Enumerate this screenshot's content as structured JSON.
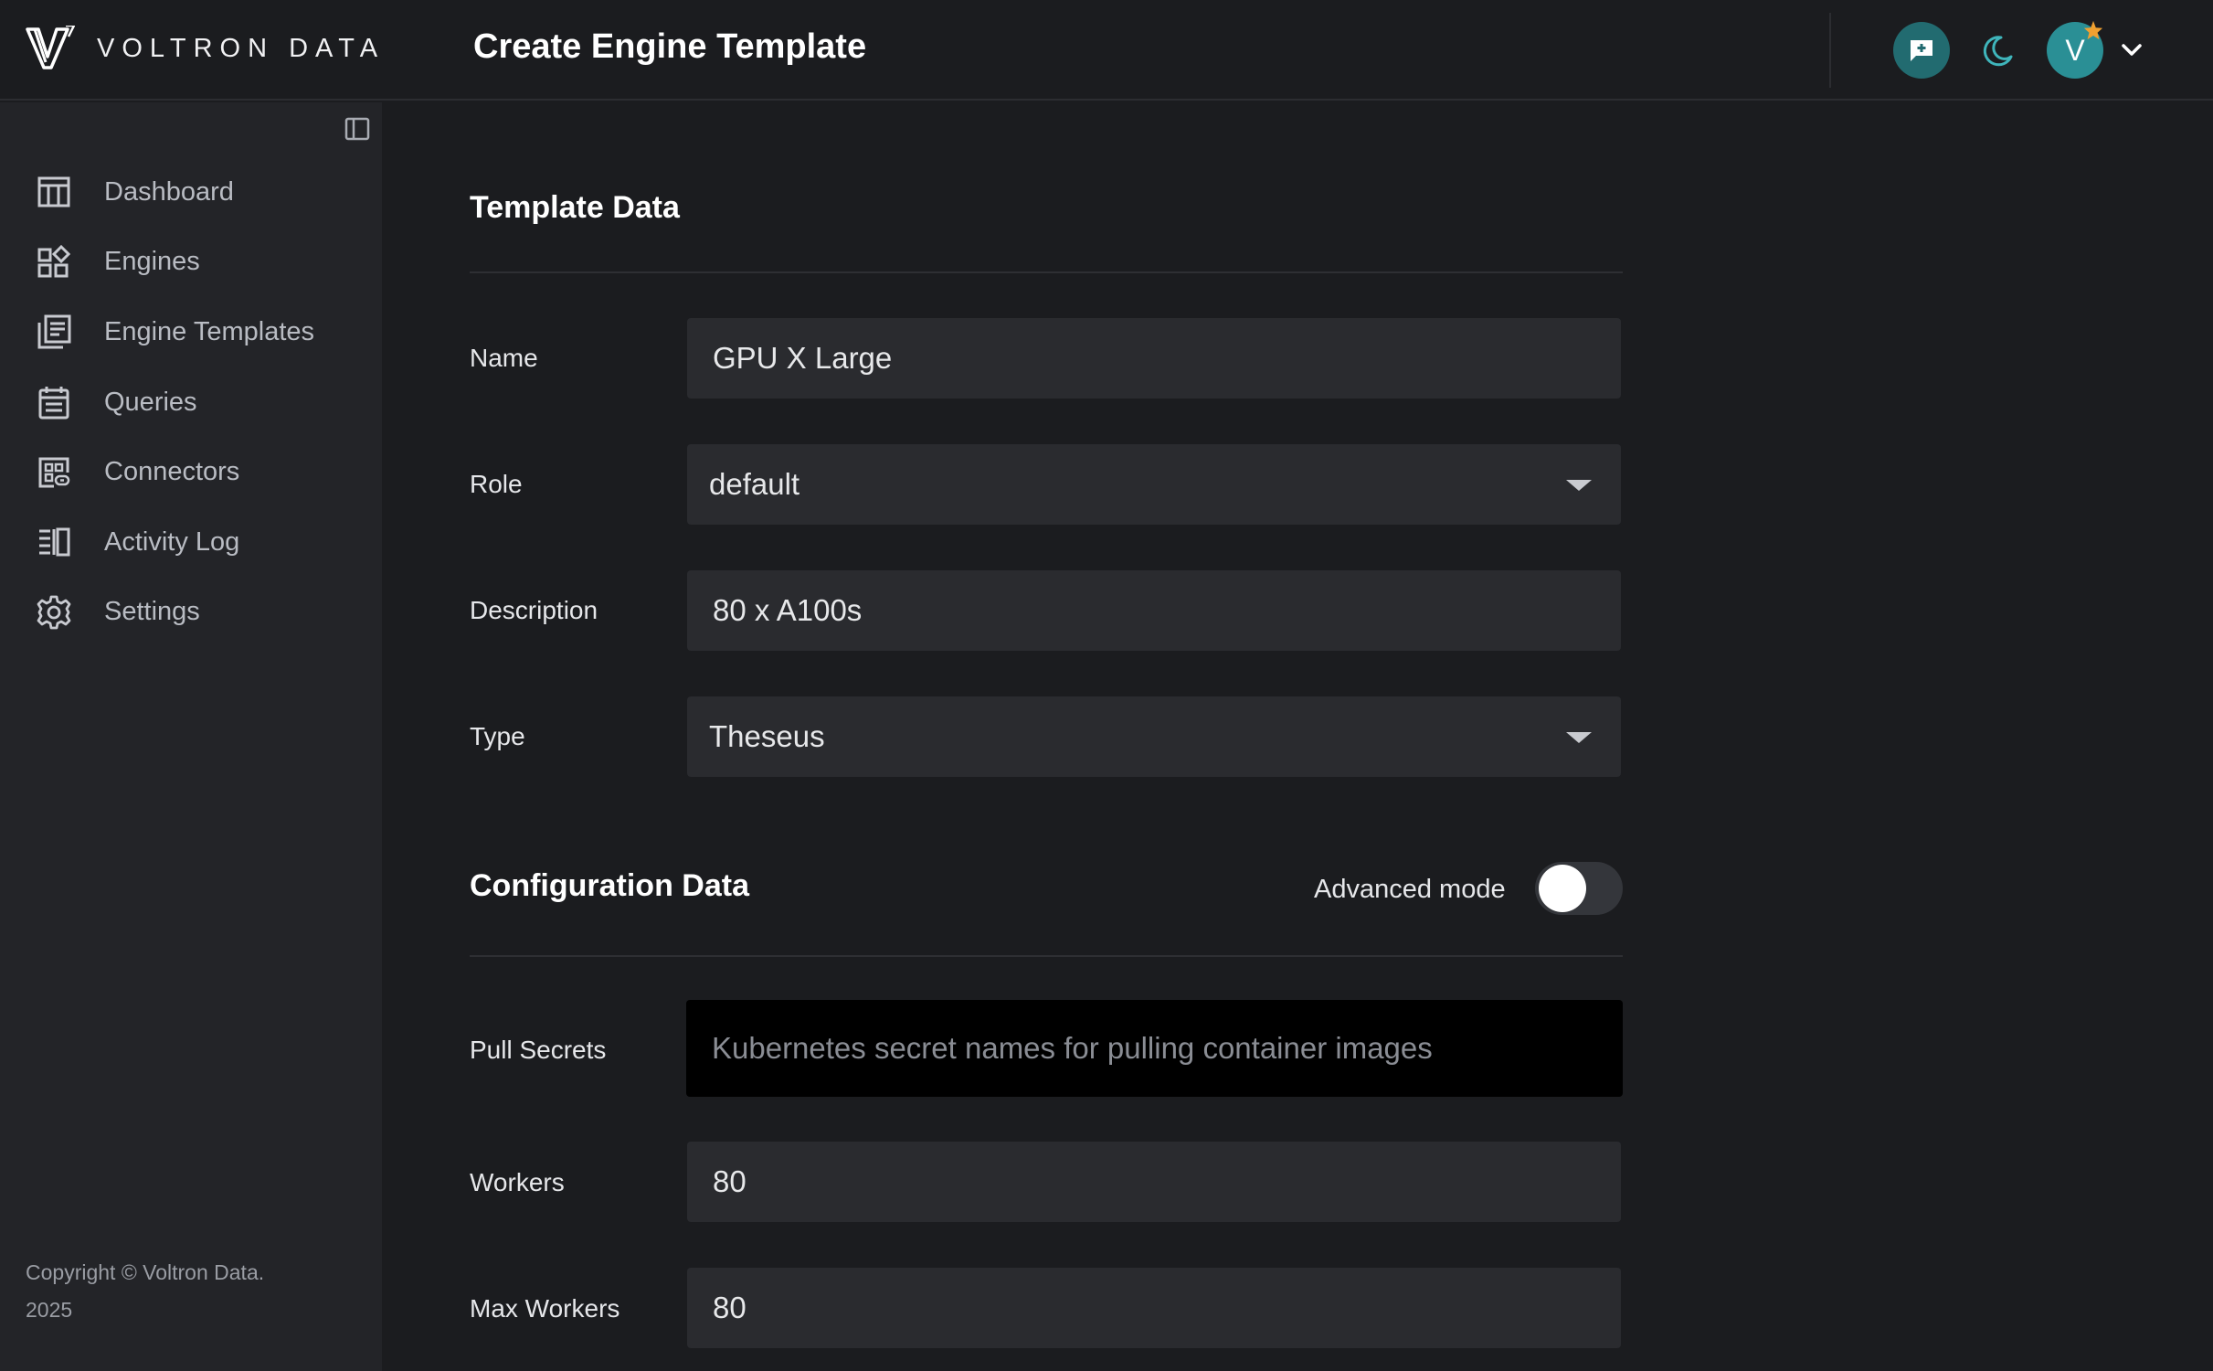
{
  "brand": {
    "name": "VOLTRON DATA"
  },
  "header": {
    "title": "Create Engine Template",
    "avatar_initial": "V"
  },
  "sidebar": {
    "items": [
      {
        "label": "Dashboard",
        "icon": "dashboard-icon"
      },
      {
        "label": "Engines",
        "icon": "engines-icon"
      },
      {
        "label": "Engine Templates",
        "icon": "engine-templates-icon"
      },
      {
        "label": "Queries",
        "icon": "queries-icon"
      },
      {
        "label": "Connectors",
        "icon": "connectors-icon"
      },
      {
        "label": "Activity Log",
        "icon": "activity-log-icon"
      },
      {
        "label": "Settings",
        "icon": "gear-icon"
      }
    ],
    "copyright": "Copyright © Voltron Data. 2025"
  },
  "template_data": {
    "title": "Template Data",
    "name_label": "Name",
    "name_value": "GPU X Large",
    "role_label": "Role",
    "role_value": "default",
    "description_label": "Description",
    "description_value": "80 x A100s",
    "type_label": "Type",
    "type_value": "Theseus"
  },
  "configuration_data": {
    "title": "Configuration Data",
    "advanced_mode_label": "Advanced mode",
    "advanced_mode_on": false,
    "pull_secrets_label": "Pull Secrets",
    "pull_secrets_placeholder": "Kubernetes secret names for pulling container images",
    "workers_label": "Workers",
    "workers_value": "80",
    "max_workers_label": "Max Workers",
    "max_workers_value": "80"
  },
  "colors": {
    "background": "#1b1c1f",
    "sidebar": "#232428",
    "accent_teal": "#2a8f95",
    "star": "#f0a030"
  }
}
